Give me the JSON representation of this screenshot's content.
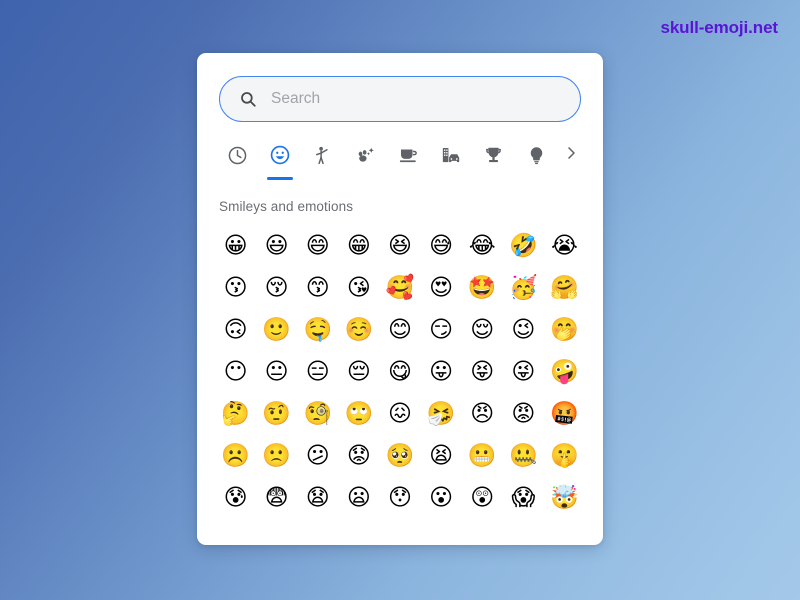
{
  "watermark": {
    "text": "skull-emoji.net",
    "color": "#5b13d6"
  },
  "theme": {
    "background_from": "#3f63ad",
    "background_to": "#a3c8e9",
    "card_background": "#ffffff",
    "accent": "#1a73e8",
    "search_border": "#4285f4",
    "search_fill": "#f4f5f7",
    "muted_text": "#6a6e73"
  },
  "search": {
    "placeholder": "Search",
    "value": "",
    "icon": "search-icon"
  },
  "tabs": {
    "items": [
      {
        "icon": "clock-icon",
        "name": "recent",
        "label": "Recently used",
        "active": false
      },
      {
        "icon": "smiley-icon",
        "name": "smileys",
        "label": "Smileys and emotions",
        "active": true
      },
      {
        "icon": "person-icon",
        "name": "people",
        "label": "People",
        "active": false
      },
      {
        "icon": "nature-icon",
        "name": "animals-nature",
        "label": "Animals and nature",
        "active": false
      },
      {
        "icon": "food-icon",
        "name": "food-drink",
        "label": "Food and drink",
        "active": false
      },
      {
        "icon": "travel-icon",
        "name": "travel-places",
        "label": "Travel and places",
        "active": false
      },
      {
        "icon": "trophy-icon",
        "name": "activities",
        "label": "Activities",
        "active": false
      },
      {
        "icon": "bulb-icon",
        "name": "objects",
        "label": "Objects",
        "active": false
      }
    ],
    "next_icon": "chevron-right-icon",
    "next_label": "More categories"
  },
  "section": {
    "title": "Smileys and emotions"
  },
  "emoji_grid": {
    "columns": 9,
    "rows": [
      [
        {
          "char": "😀",
          "name": "grinning-face"
        },
        {
          "char": "😃",
          "name": "grinning-face-with-big-eyes"
        },
        {
          "char": "😄",
          "name": "grinning-face-with-smiling-eyes"
        },
        {
          "char": "😁",
          "name": "beaming-face-with-smiling-eyes"
        },
        {
          "char": "😆",
          "name": "grinning-squinting-face"
        },
        {
          "char": "😅",
          "name": "grinning-face-with-sweat"
        },
        {
          "char": "😂",
          "name": "face-with-tears-of-joy"
        },
        {
          "char": "🤣",
          "name": "rolling-on-the-floor-laughing"
        },
        {
          "char": "😭",
          "name": "loudly-crying-face"
        }
      ],
      [
        {
          "char": "😗",
          "name": "kissing-face"
        },
        {
          "char": "😚",
          "name": "kissing-face-with-closed-eyes"
        },
        {
          "char": "😙",
          "name": "kissing-face-with-smiling-eyes"
        },
        {
          "char": "😘",
          "name": "face-blowing-a-kiss"
        },
        {
          "char": "🥰",
          "name": "smiling-face-with-hearts"
        },
        {
          "char": "😍",
          "name": "smiling-face-with-heart-eyes"
        },
        {
          "char": "🤩",
          "name": "star-struck"
        },
        {
          "char": "🥳",
          "name": "partying-face"
        },
        {
          "char": "🤗",
          "name": "hugging-face"
        }
      ],
      [
        {
          "char": "🙃",
          "name": "upside-down-face"
        },
        {
          "char": "🙂",
          "name": "slightly-smiling-face"
        },
        {
          "char": "🤤",
          "name": "drooling-face"
        },
        {
          "char": "☺️",
          "name": "smiling-face"
        },
        {
          "char": "😊",
          "name": "smiling-face-with-smiling-eyes"
        },
        {
          "char": "😏",
          "name": "smirking-face"
        },
        {
          "char": "😌",
          "name": "relieved-face"
        },
        {
          "char": "😉",
          "name": "winking-face"
        },
        {
          "char": "🤭",
          "name": "face-with-hand-over-mouth"
        }
      ],
      [
        {
          "char": "😶",
          "name": "face-without-mouth"
        },
        {
          "char": "😐",
          "name": "neutral-face"
        },
        {
          "char": "😑",
          "name": "expressionless-face"
        },
        {
          "char": "😔",
          "name": "pensive-face"
        },
        {
          "char": "😋",
          "name": "face-savoring-food"
        },
        {
          "char": "😛",
          "name": "face-with-tongue"
        },
        {
          "char": "😝",
          "name": "squinting-face-with-tongue"
        },
        {
          "char": "😜",
          "name": "winking-face-with-tongue"
        },
        {
          "char": "🤪",
          "name": "zany-face"
        }
      ],
      [
        {
          "char": "🤔",
          "name": "thinking-face"
        },
        {
          "char": "🤨",
          "name": "face-with-raised-eyebrow"
        },
        {
          "char": "🧐",
          "name": "face-with-monocle"
        },
        {
          "char": "🙄",
          "name": "face-with-rolling-eyes"
        },
        {
          "char": "😖",
          "name": "confounded-face"
        },
        {
          "char": "🤧",
          "name": "sneezing-face"
        },
        {
          "char": "😠",
          "name": "angry-face"
        },
        {
          "char": "😡",
          "name": "pouting-face"
        },
        {
          "char": "🤬",
          "name": "face-with-symbols-on-mouth"
        }
      ],
      [
        {
          "char": "☹️",
          "name": "frowning-face"
        },
        {
          "char": "🙁",
          "name": "slightly-frowning-face"
        },
        {
          "char": "😕",
          "name": "confused-face"
        },
        {
          "char": "😟",
          "name": "worried-face"
        },
        {
          "char": "🥺",
          "name": "pleading-face"
        },
        {
          "char": "😫",
          "name": "tired-face"
        },
        {
          "char": "😬",
          "name": "grimacing-face"
        },
        {
          "char": "🤐",
          "name": "zipper-mouth-face"
        },
        {
          "char": "🤫",
          "name": "shushing-face"
        }
      ],
      [
        {
          "char": "😰",
          "name": "anxious-face-with-sweat"
        },
        {
          "char": "😨",
          "name": "fearful-face"
        },
        {
          "char": "😧",
          "name": "anguished-face"
        },
        {
          "char": "😦",
          "name": "frowning-face-with-open-mouth"
        },
        {
          "char": "😯",
          "name": "hushed-face"
        },
        {
          "char": "😮",
          "name": "face-with-open-mouth"
        },
        {
          "char": "😲",
          "name": "astonished-face"
        },
        {
          "char": "😱",
          "name": "face-screaming-in-fear"
        },
        {
          "char": "🤯",
          "name": "exploding-head"
        }
      ]
    ]
  }
}
